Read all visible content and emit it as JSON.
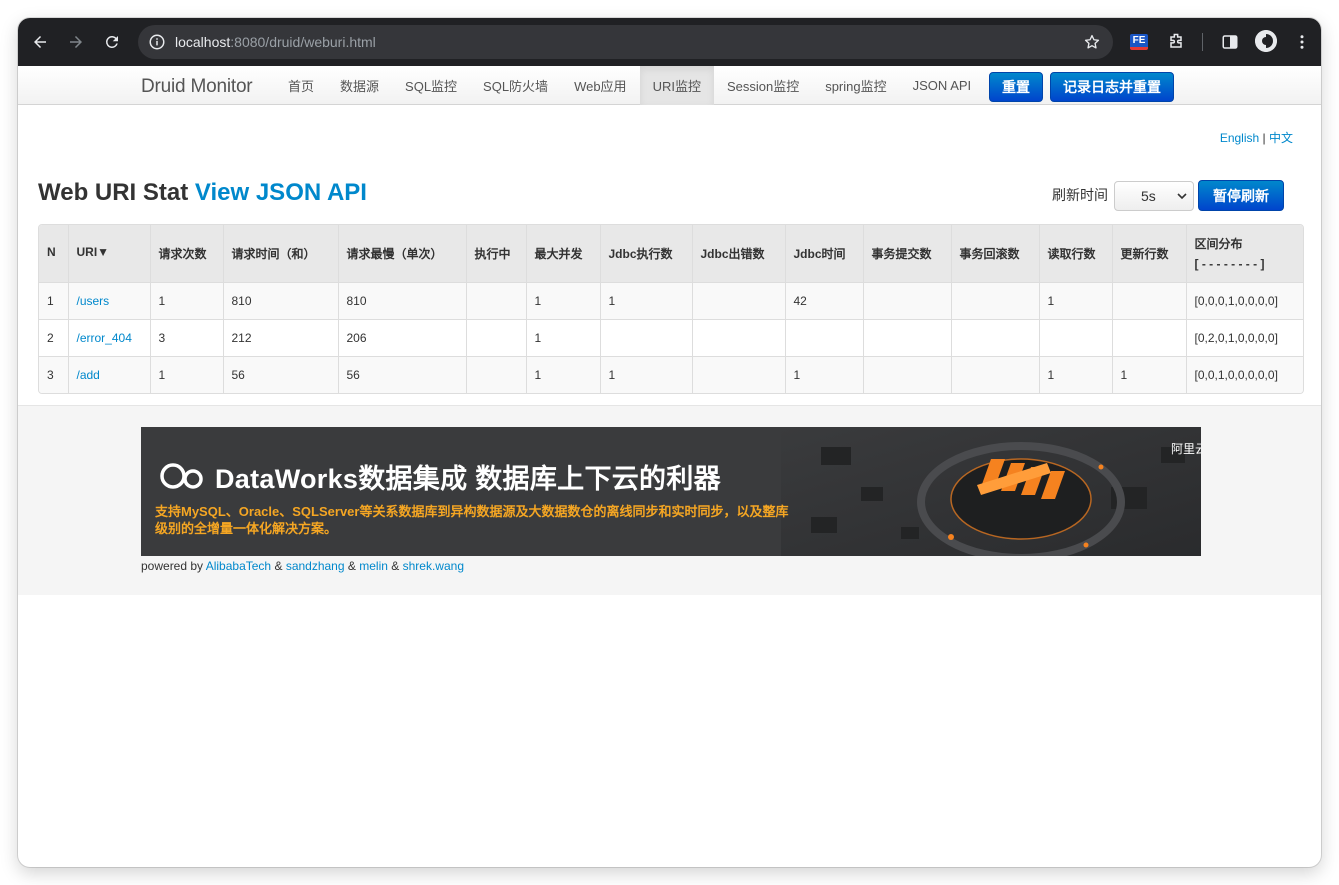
{
  "browser": {
    "url_host": "localhost",
    "url_rest": ":8080/druid/weburi.html"
  },
  "navbar": {
    "brand": "Druid Monitor",
    "items": [
      {
        "label": "首页"
      },
      {
        "label": "数据源"
      },
      {
        "label": "SQL监控"
      },
      {
        "label": "SQL防火墙"
      },
      {
        "label": "Web应用"
      },
      {
        "label": "URI监控",
        "active": true
      },
      {
        "label": "Session监控"
      },
      {
        "label": "spring监控"
      },
      {
        "label": "JSON API"
      }
    ],
    "reset_label": "重置",
    "log_reset_label": "记录日志并重置"
  },
  "lang": {
    "english": "English",
    "sep": "|",
    "chinese": "中文"
  },
  "page": {
    "title": "Web URI Stat",
    "json_link": "View JSON API",
    "refresh_label": "刷新时间",
    "refresh_value": "5s",
    "pause_label": "暂停刷新"
  },
  "table": {
    "headers": [
      "N",
      "URI▼",
      "请求次数",
      "请求时间（和）",
      "请求最慢（单次）",
      "执行中",
      "最大并发",
      "Jdbc执行数",
      "Jdbc出错数",
      "Jdbc时间",
      "事务提交数",
      "事务回滚数",
      "读取行数",
      "更新行数",
      "区间分布"
    ],
    "dist_sub": "[ - - - - - - - - ]",
    "rows": [
      [
        "1",
        "/users",
        "1",
        "810",
        "810",
        "",
        "1",
        "1",
        "",
        "42",
        "",
        "",
        "1",
        "",
        "[0,0,0,1,0,0,0,0]"
      ],
      [
        "2",
        "/error_404",
        "3",
        "212",
        "206",
        "",
        "1",
        "",
        "",
        "",
        "",
        "",
        "",
        "",
        "[0,2,0,1,0,0,0,0]"
      ],
      [
        "3",
        "/add",
        "1",
        "56",
        "56",
        "",
        "1",
        "1",
        "",
        "1",
        "",
        "",
        "1",
        "1",
        "[0,0,1,0,0,0,0,0]"
      ]
    ]
  },
  "banner": {
    "title": "DataWorks数据集成 数据库上下云的利器",
    "subtitle": "支持MySQL、Oracle、SQLServer等关系数据库到异构数据源及大数据数仓的离线同步和实时同步，以及整库级别的全增量一体化解决方案。",
    "brand": "阿里云"
  },
  "footer": {
    "prefix": "powered by",
    "amp": "&",
    "authors": [
      "AlibabaTech",
      "sandzhang",
      "melin",
      "shrek.wang"
    ]
  },
  "colors": {
    "link": "#0088cc",
    "primary": "#0044cc",
    "banner_accent": "#f5a623"
  }
}
